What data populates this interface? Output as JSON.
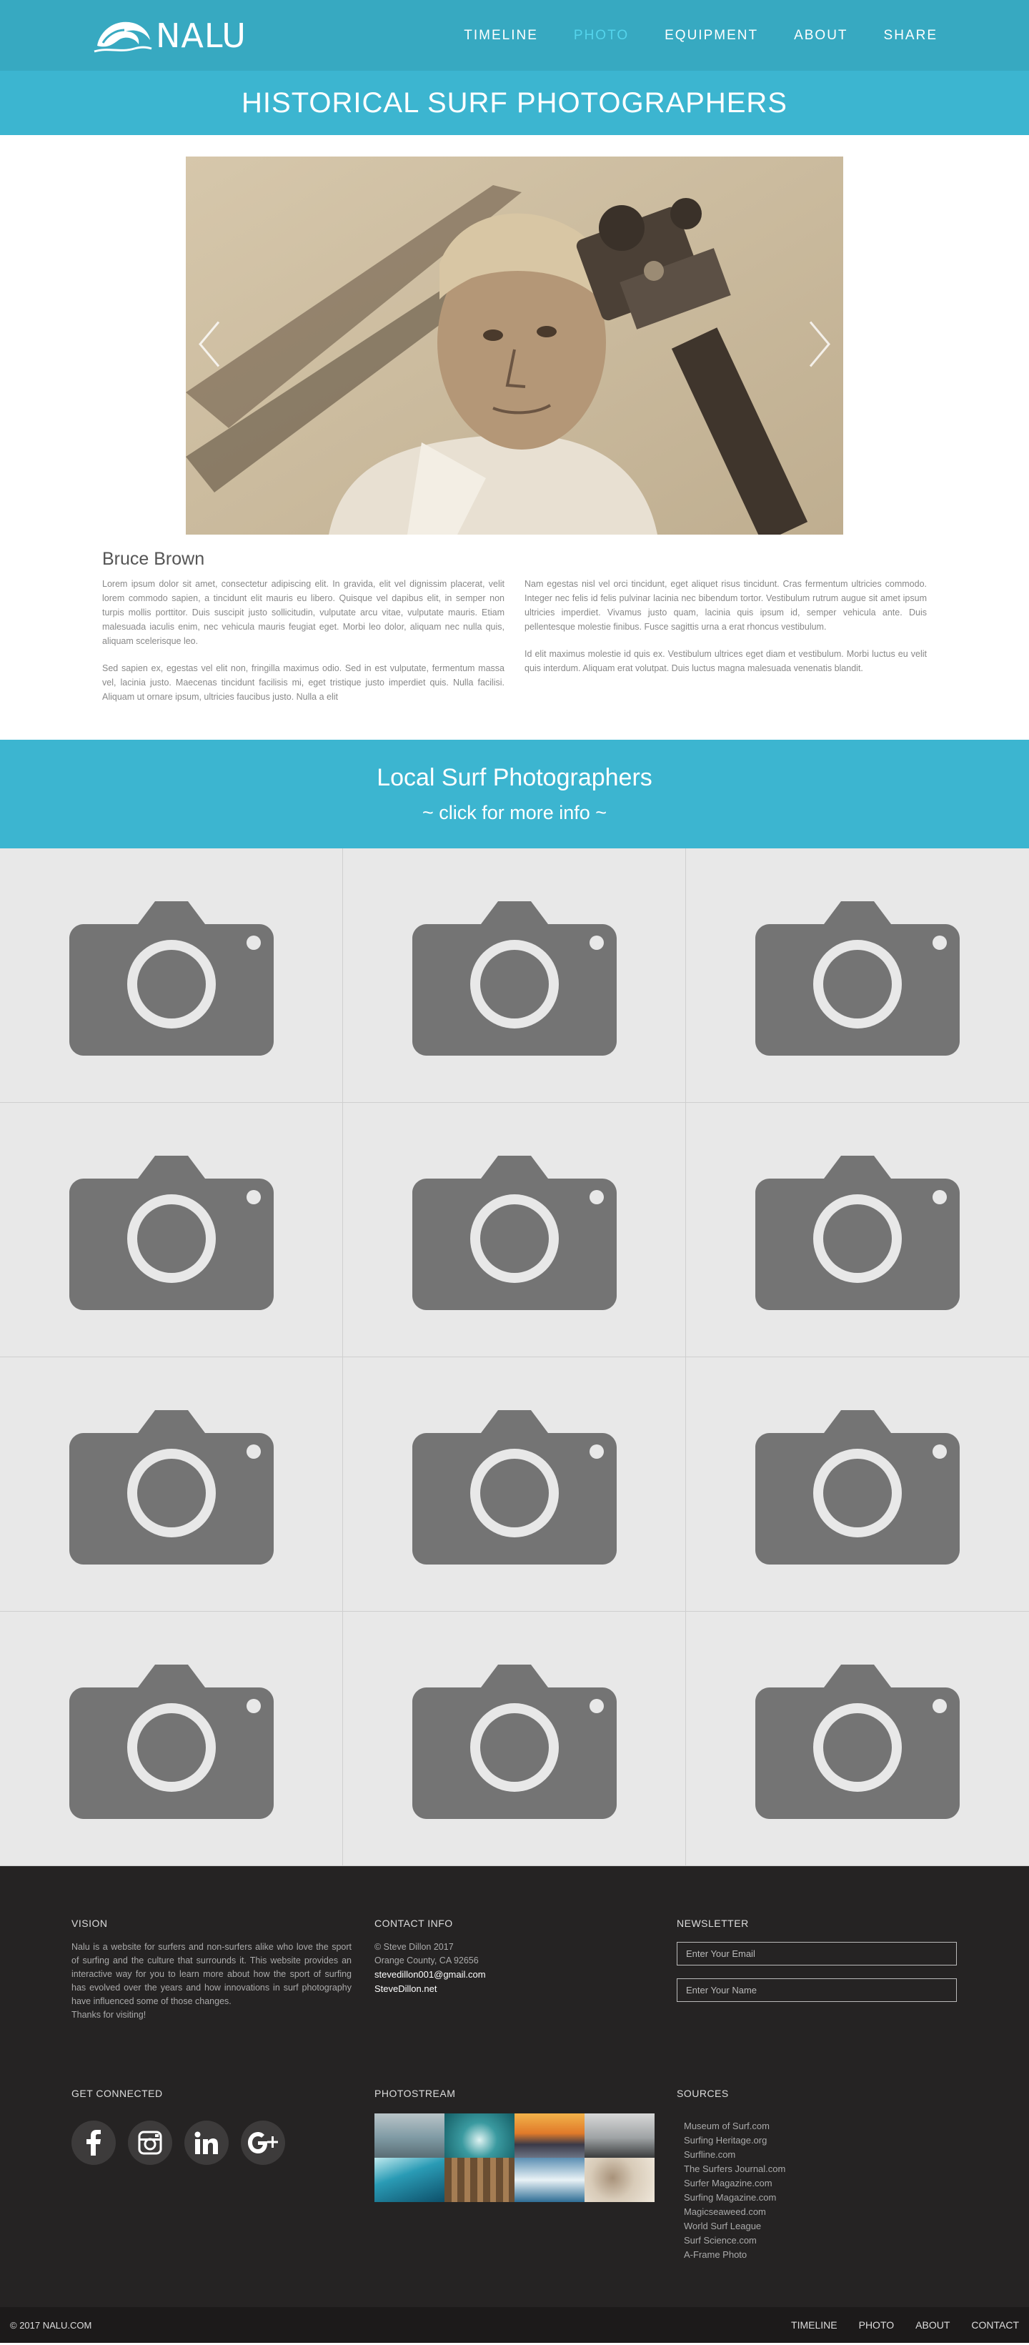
{
  "brand": {
    "logo_text": "NALU"
  },
  "nav": {
    "items": [
      "TIMELINE",
      "PHOTO",
      "EQUIPMENT",
      "ABOUT",
      "SHARE"
    ],
    "active": "PHOTO"
  },
  "banner": {
    "title": "HISTORICAL SURF PHOTOGRAPHERS"
  },
  "slider": {
    "prev_icon": "chevron-left-icon",
    "next_icon": "chevron-right-icon"
  },
  "bio": {
    "name": "Bruce Brown",
    "col1": [
      "Lorem ipsum dolor sit amet, consectetur adipiscing elit. In gravida, elit vel dignissim placerat, velit lorem commodo sapien, a tincidunt elit mauris eu libero. Quisque vel dapibus elit, in semper non turpis mollis porttitor. Duis suscipit justo sollicitudin, vulputate arcu vitae, vulputate mauris. Etiam malesuada iaculis enim, nec vehicula mauris feugiat eget. Morbi leo dolor, aliquam nec nulla quis, aliquam scelerisque leo.",
      "Sed sapien ex, egestas vel elit non, fringilla maximus odio. Sed in est vulputate, fermentum massa vel, lacinia justo. Maecenas tincidunt facilisis mi, eget tristique justo imperdiet quis. Nulla facilisi. Aliquam ut ornare ipsum, ultricies faucibus justo. Nulla a elit"
    ],
    "col2": [
      "Nam egestas nisl vel orci tincidunt, eget aliquet risus tincidunt. Cras fermentum ultricies commodo. Integer nec felis id felis pulvinar lacinia nec bibendum tortor. Vestibulum rutrum augue sit amet ipsum ultricies imperdiet. Vivamus justo quam, lacinia quis ipsum id, semper vehicula ante. Duis pellentesque molestie finibus. Fusce sagittis urna a erat rhoncus vestibulum.",
      "Id elit maximus molestie id quis ex. Vestibulum ultrices eget diam et vestibulum. Morbi luctus eu velit quis interdum. Aliquam erat volutpat. Duis luctus magna malesuada venenatis blandit."
    ]
  },
  "local": {
    "title": "Local Surf Photographers",
    "subtitle": "~ click for more info ~",
    "tile_count": 12,
    "tile_icon": "camera-icon"
  },
  "footer": {
    "vision": {
      "heading": "VISION",
      "text": "Nalu is a website for surfers and non-surfers alike who love the sport of surfing and the culture that surrounds it. This website provides an interactive way for you to learn more about how the sport of surfing has evolved over the years and how innovations in surf photography have influenced some of those changes.",
      "thanks": "Thanks for visiting!"
    },
    "contact": {
      "heading": "CONTACT INFO",
      "copyright": "© Steve Dillon 2017",
      "location": "Orange County, CA 92656",
      "email": "stevedillon001@gmail.com",
      "site": "SteveDillon.net"
    },
    "newsletter": {
      "heading": "NEWSLETTER",
      "email_placeholder": "Enter Your Email",
      "name_placeholder": "Enter Your Name"
    },
    "social": {
      "heading": "GET CONNECTED",
      "icons": [
        "facebook-icon",
        "instagram-icon",
        "linkedin-icon",
        "google-plus-icon"
      ]
    },
    "photostream": {
      "heading": "PHOTOSTREAM"
    },
    "sources": {
      "heading": "SOURCES",
      "items": [
        "Museum of Surf.com",
        "Surfing Heritage.org",
        "Surfline.com",
        "The Surfers Journal.com",
        "Surfer Magazine.com",
        "Surfing Magazine.com",
        "Magicseaweed.com",
        "World Surf League",
        "Surf Science.com",
        "A-Frame Photo"
      ]
    }
  },
  "bottom": {
    "copyright": "© 2017 NALU.COM",
    "links": [
      "TIMELINE",
      "PHOTO",
      "ABOUT",
      "CONTACT"
    ]
  },
  "colors": {
    "nav": "#37a9c1",
    "accent": "#3cb5d0",
    "active_link": "#54d4ec",
    "footer": "#252323"
  }
}
